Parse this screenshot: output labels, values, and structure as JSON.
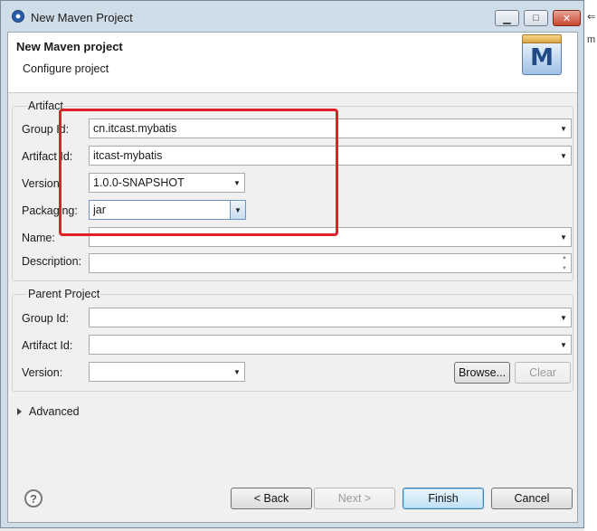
{
  "window": {
    "title": "New Maven Project",
    "min_glyph": "▁",
    "max_glyph": "□",
    "close_glyph": "✕"
  },
  "header": {
    "title": "New Maven project",
    "subtitle": "Configure project",
    "logo_letter": "M"
  },
  "artifact": {
    "legend": "Artifact",
    "group_id": {
      "label": "Group Id:",
      "value": "cn.itcast.mybatis"
    },
    "artifact_id": {
      "label": "Artifact Id:",
      "value": "itcast-mybatis"
    },
    "version": {
      "label": "Version:",
      "value": "1.0.0-SNAPSHOT"
    },
    "packaging": {
      "label": "Packaging:",
      "value": "jar"
    },
    "name": {
      "label": "Name:",
      "value": ""
    },
    "description": {
      "label": "Description:",
      "value": ""
    }
  },
  "parent": {
    "legend": "Parent Project",
    "group_id": {
      "label": "Group Id:",
      "value": ""
    },
    "artifact_id": {
      "label": "Artifact Id:",
      "value": ""
    },
    "version": {
      "label": "Version:",
      "value": ""
    },
    "browse_label": "Browse...",
    "clear_label": "Clear"
  },
  "advanced": {
    "label": "Advanced"
  },
  "footer": {
    "help_glyph": "?",
    "back_label": "< Back",
    "next_label": "Next >",
    "finish_label": "Finish",
    "cancel_label": "Cancel"
  },
  "background": {
    "frag1": "⇐",
    "frag2": "m"
  },
  "colors": {
    "highlight": "#e0202a",
    "title_bar": "#cfdde9",
    "default_button": "#3c7fb1"
  },
  "icons": {
    "dropdown": "▼",
    "spin_up": "▲",
    "spin_down": "▼"
  }
}
